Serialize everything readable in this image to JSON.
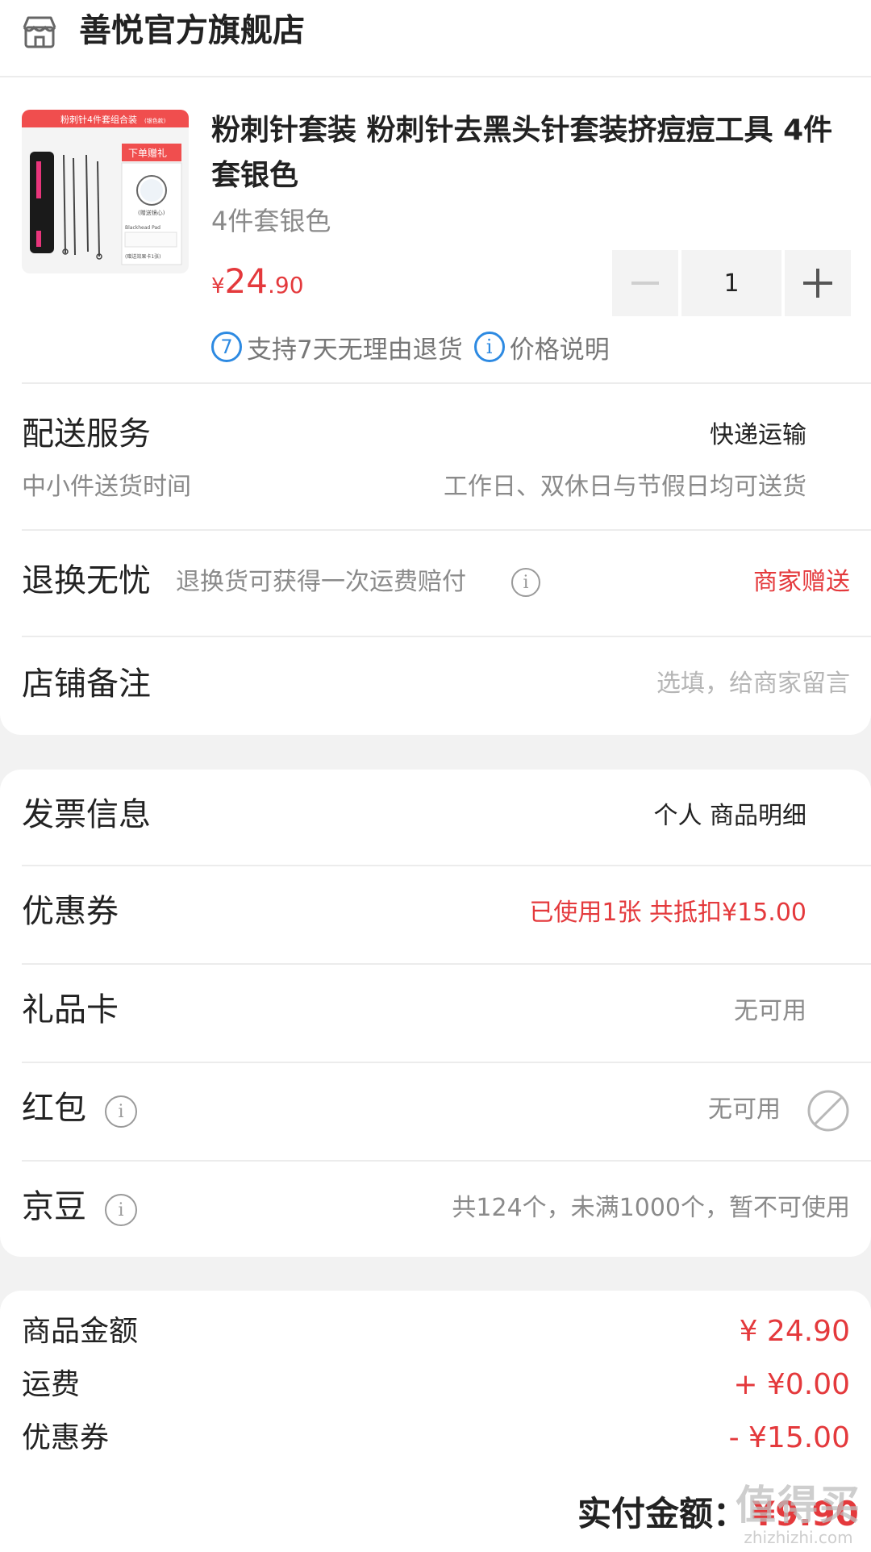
{
  "store": {
    "name": "善悦官方旗舰店"
  },
  "product": {
    "title": "粉刺针套装 粉刺针去黑头针套装挤痘痘工具 4件套银色",
    "spec": "4件套银色",
    "price_currency": "¥",
    "price_integer": "24",
    "price_decimal": ".90",
    "quantity": "1",
    "services": [
      "支持7天无理由退货",
      "价格说明"
    ],
    "service_7day_badge": "7"
  },
  "thumbnail": {
    "banner": "粉刺针4件套组合装",
    "banner_small": "(银色款)",
    "tag": "下单赠礼",
    "caption": "(赠送镜心)",
    "card_title": "Blackhead Pad",
    "footer": "(赠送效果卡1张)"
  },
  "delivery": {
    "label": "配送服务",
    "value": "快递运输",
    "sub_label": "中小件送货时间",
    "sub_value": "工作日、双休日与节假日均可送货"
  },
  "return_worry_free": {
    "label": "退换无忧",
    "desc": "退换货可获得一次运费赔付",
    "value": "商家赠送"
  },
  "store_note": {
    "label": "店铺备注",
    "placeholder": "选填，给商家留言"
  },
  "invoice": {
    "label": "发票信息",
    "value": "个人 商品明细"
  },
  "coupon": {
    "label": "优惠券",
    "value": "已使用1张 共抵扣¥15.00"
  },
  "gift_card": {
    "label": "礼品卡",
    "value": "无可用"
  },
  "red_packet": {
    "label": "红包",
    "value": "无可用"
  },
  "jingdou": {
    "label": "京豆",
    "value": "共124个，未满1000个，暂不可使用"
  },
  "summary": {
    "goods_label": "商品金额",
    "goods_value": "¥ 24.90",
    "shipping_label": "运费",
    "shipping_value": "+ ¥0.00",
    "coupon_label": "优惠券",
    "coupon_value": "- ¥15.00"
  },
  "total": {
    "label": "实付金额：",
    "value": "¥9.90"
  },
  "watermark": {
    "line1": "值得买",
    "line2": "zhizhizhi.com"
  },
  "colors": {
    "accent_red": "#e4393c",
    "info_blue": "#2d8ae2",
    "page_bg": "#f2f2f2"
  }
}
